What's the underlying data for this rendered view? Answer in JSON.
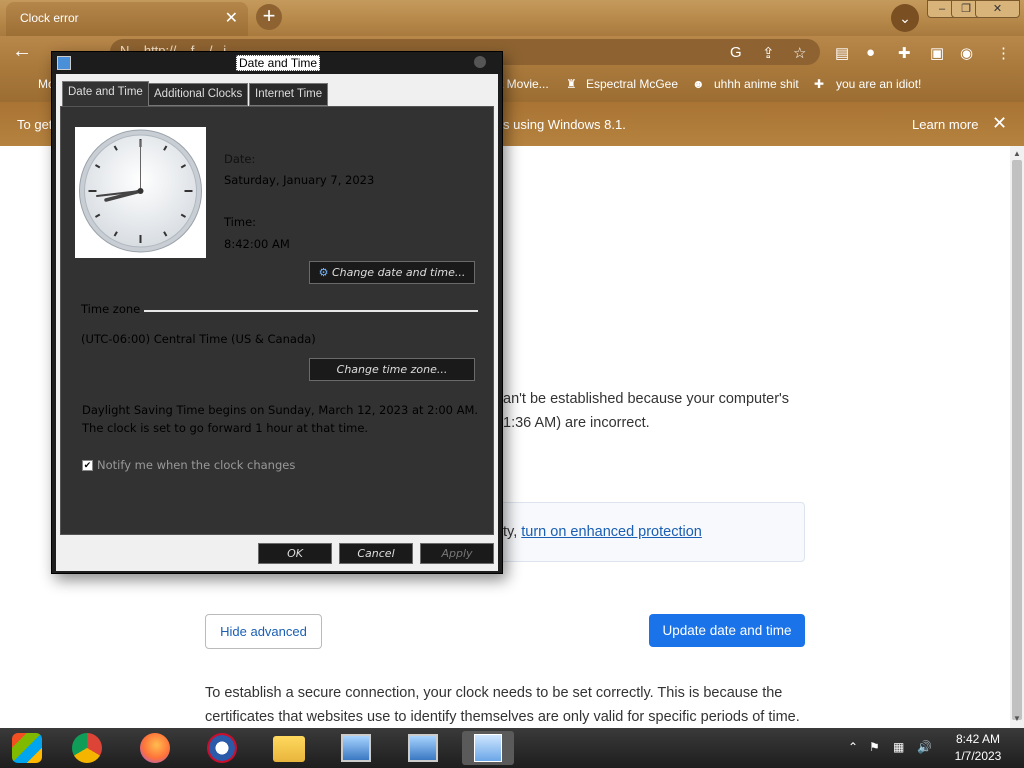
{
  "browser": {
    "tab_title": "Clock error",
    "address_partial": "N...   http://...   f...   /...i...",
    "bookmarks": [
      "Mo",
      "t Movie...",
      "Espectral McGee",
      "uhhh anime shit",
      "you are an idiot!"
    ],
    "infobar_text_left": "To get",
    "infobar_text_right": "s using Windows 8.1.",
    "learn_more": "Learn more"
  },
  "page": {
    "error_line1": "an't be established because your computer's",
    "error_line2": "1:36 AM) are incorrect.",
    "enhanced_prefix": "ty, ",
    "enhanced_link": "turn on enhanced protection",
    "hide_advanced": "Hide advanced",
    "update_button": "Update date and time",
    "explain_line1": "To establish a secure connection, your clock needs to be set correctly. This is because the",
    "explain_line2": "certificates that websites use to identify themselves are only valid for specific periods of time."
  },
  "dialog": {
    "title": "Date and Time",
    "tabs": [
      "Date and Time",
      "Additional Clocks",
      "Internet Time"
    ],
    "date_label": "Date:",
    "date_value": "Saturday, January 7, 2023",
    "time_label": "Time:",
    "time_value": "8:42:00 AM",
    "change_date_btn": "Change date and time...",
    "timezone_label": "Time zone",
    "timezone_value": "(UTC-06:00) Central Time (US & Canada)",
    "change_tz_btn": "Change time zone...",
    "dst_line1": "Daylight Saving Time begins on Sunday, March 12, 2023 at 2:00 AM.",
    "dst_line2": "The clock is set to go forward 1 hour at that time.",
    "notify_label": "Notify me when the clock changes",
    "notify_checked": true,
    "ok": "OK",
    "cancel": "Cancel",
    "apply": "Apply"
  },
  "taskbar": {
    "time": "8:42 AM",
    "date": "1/7/2023"
  }
}
